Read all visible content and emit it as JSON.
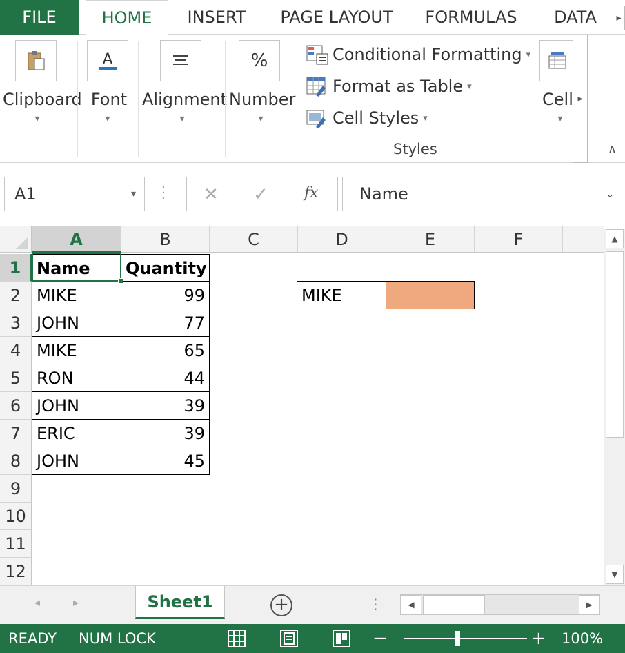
{
  "ribbon_tabs": [
    "FILE",
    "HOME",
    "INSERT",
    "PAGE LAYOUT",
    "FORMULAS",
    "DATA"
  ],
  "ribbon_groups": {
    "clipboard": "Clipboard",
    "font": "Font",
    "alignment": "Alignment",
    "number": "Number",
    "cells": "Cell",
    "conditional_formatting": "Conditional Formatting",
    "format_as_table": "Format as Table",
    "cell_styles": "Cell Styles",
    "styles": "Styles"
  },
  "formula_bar": {
    "name_box": "A1",
    "fx": "fx",
    "formula": "Name"
  },
  "columns": [
    "A",
    "B",
    "C",
    "D",
    "E",
    "F"
  ],
  "rows": [
    "1",
    "2",
    "3",
    "4",
    "5",
    "6",
    "7",
    "8",
    "9",
    "10",
    "11",
    "12"
  ],
  "table": {
    "header": [
      "Name",
      "Quantity"
    ],
    "rows": [
      [
        "MIKE",
        "99"
      ],
      [
        "JOHN",
        "77"
      ],
      [
        "MIKE",
        "65"
      ],
      [
        "RON",
        "44"
      ],
      [
        "JOHN",
        "39"
      ],
      [
        "ERIC",
        "39"
      ],
      [
        "JOHN",
        "45"
      ]
    ]
  },
  "lookup_cell": {
    "d2": "MIKE",
    "e2_fill": "#F0A97F"
  },
  "sheet_tab": "Sheet1",
  "status": {
    "ready": "READY",
    "numlock": "NUM LOCK",
    "zoom": "100%"
  },
  "colors": {
    "accent": "#217346",
    "selected_header": "#D3D3D3"
  }
}
